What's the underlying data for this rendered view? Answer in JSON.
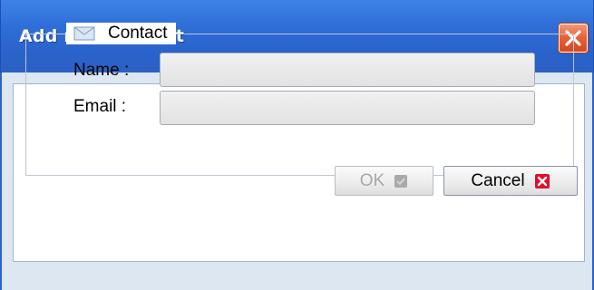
{
  "window": {
    "title": "Add new contact",
    "close_icon": "close-icon"
  },
  "fieldset": {
    "legend": "Contact",
    "legend_icon": "envelope-icon"
  },
  "form": {
    "name_label": "Name :",
    "name_value": "",
    "email_label": "Email :",
    "email_value": ""
  },
  "buttons": {
    "ok_label": "OK",
    "ok_enabled": false,
    "ok_icon": "checkmark-icon",
    "cancel_label": "Cancel",
    "cancel_icon": "cancel-x-icon"
  },
  "colors": {
    "title_bar": "#2a63cb",
    "close_button": "#e8643a",
    "cancel_icon": "#e0102a"
  }
}
